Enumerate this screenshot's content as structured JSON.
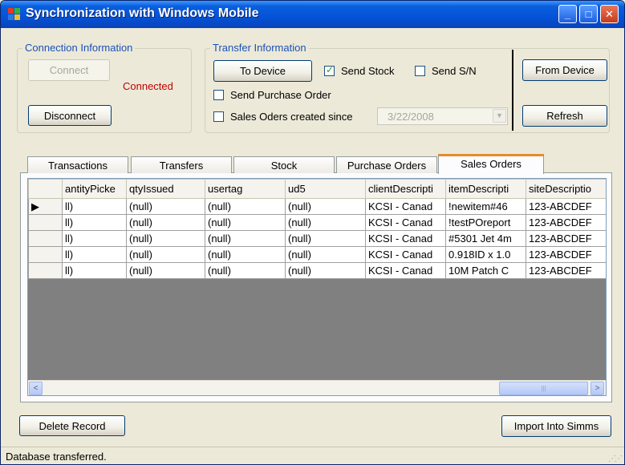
{
  "window": {
    "title": "Synchronization with Windows Mobile",
    "controls": {
      "minimize": "_",
      "maximize": "□",
      "close": "✕"
    }
  },
  "connection": {
    "group_label": "Connection Information",
    "connect_label": "Connect",
    "status_text": "Connected",
    "disconnect_label": "Disconnect"
  },
  "transfer": {
    "group_label": "Transfer Information",
    "to_device_label": "To Device",
    "send_stock": {
      "label": "Send Stock",
      "checked": true
    },
    "send_sn": {
      "label": "Send S/N",
      "checked": false
    },
    "send_po": {
      "label": "Send Purchase Order",
      "checked": false
    },
    "sales_since": {
      "label": "Sales Oders created since",
      "checked": false
    },
    "date_value": "3/22/2008",
    "from_device_label": "From Device",
    "refresh_label": "Refresh"
  },
  "tabs": [
    {
      "label": "Transactions"
    },
    {
      "label": "Transfers"
    },
    {
      "label": "Stock"
    },
    {
      "label": "Purchase Orders"
    },
    {
      "label": "Sales Orders",
      "active": true
    }
  ],
  "grid": {
    "columns": [
      "antityPicke",
      "qtyIssued",
      "usertag",
      "ud5",
      "clientDescripti",
      "itemDescripti",
      "siteDescriptio"
    ],
    "rows": [
      [
        "ll)",
        "(null)",
        "(null)",
        "(null)",
        "KCSI - Canad",
        "!newitem#46",
        "123-ABCDEF"
      ],
      [
        "ll)",
        "(null)",
        "(null)",
        "(null)",
        "KCSI - Canad",
        "!testPOreport",
        "123-ABCDEF"
      ],
      [
        "ll)",
        "(null)",
        "(null)",
        "(null)",
        "KCSI - Canad",
        "#5301 Jet 4m",
        "123-ABCDEF"
      ],
      [
        "ll)",
        "(null)",
        "(null)",
        "(null)",
        "KCSI - Canad",
        "0.918ID x 1.0",
        "123-ABCDEF"
      ],
      [
        "ll)",
        "(null)",
        "(null)",
        "(null)",
        "KCSI - Canad",
        "10M Patch C",
        "123-ABCDEF"
      ]
    ],
    "current_row_marker": "▶"
  },
  "scroll": {
    "left": "<",
    "right": ">",
    "grip": "|||"
  },
  "footer": {
    "delete_label": "Delete Record",
    "import_label": "Import Into Simms"
  },
  "status": {
    "text": "Database transferred."
  },
  "colors": {
    "connected": "#c00000",
    "group_label": "#1b50b8",
    "active_tab": "#e68b2c"
  }
}
